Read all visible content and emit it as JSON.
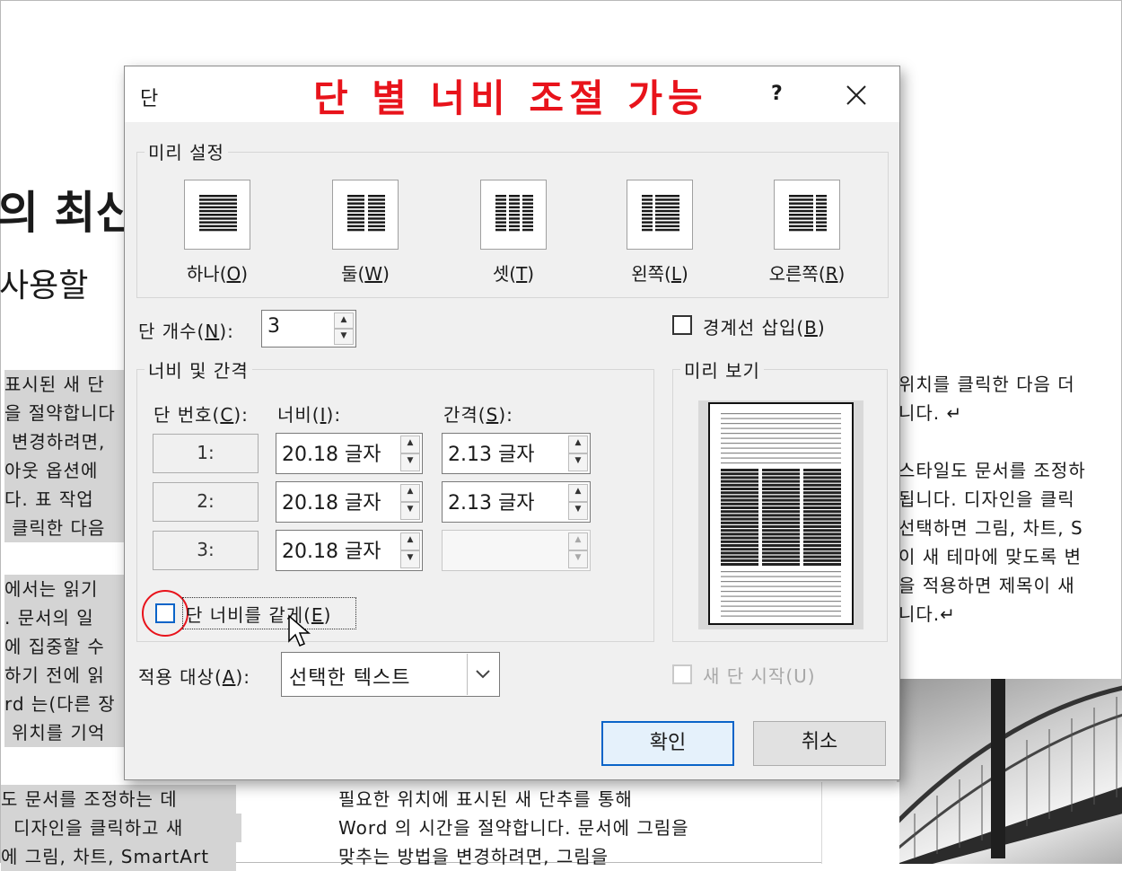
{
  "document": {
    "title_fragment": "의 최신",
    "subtitle_fragment": "사용할",
    "left_column": [
      "표시된 새 단",
      "을 절약합니다",
      "변경하려면,",
      "아웃 옵션에",
      "다. 표 작업 ",
      "클릭한 다음",
      "에서는 읽기",
      ". 문서의 일",
      "에 집중할 수",
      "하기 전에 읽",
      "rd 는(다른 장",
      "위치를 기억"
    ],
    "right_column": [
      "위치를 클릭한 다음 더",
      "니다. ↵",
      "스타일도 문서를 조정하",
      "됩니다. 디자인을 클릭",
      "선택하면 그림, 차트, S",
      "이 새 테마에 맞도록 변",
      "을 적용하면 제목이 새",
      "니다.↵"
    ],
    "bottom_left": [
      "도 문서를 조정하는 데",
      "디자인을 클릭하고 새",
      "에 그림, 차트, SmartArt"
    ],
    "bottom_center": [
      "필요한 위치에 표시된 새 단추를 통해",
      "Word 의 시간을 절약합니다. 문서에 그림을",
      "맞추는 방법을 변경하려면, 그림을"
    ]
  },
  "dialog": {
    "title": "단",
    "banner": "단 별 너비 조절 가능",
    "help": "?",
    "presets_label": "미리 설정",
    "presets": [
      {
        "label": "하나(",
        "key": "O",
        "tail": ")",
        "icon": "one-column-icon"
      },
      {
        "label": "둘(",
        "key": "W",
        "tail": ")",
        "icon": "two-columns-icon"
      },
      {
        "label": "셋(",
        "key": "T",
        "tail": ")",
        "icon": "three-columns-icon"
      },
      {
        "label": "왼쪽(",
        "key": "L",
        "tail": ")",
        "icon": "left-column-icon"
      },
      {
        "label": "오른쪽(",
        "key": "R",
        "tail": ")",
        "icon": "right-column-icon"
      }
    ],
    "num_columns_label": "단 개수(",
    "num_columns_key": "N",
    "num_columns_tail": "):",
    "num_columns_value": "3",
    "line_between_label": "경계선 삽입(",
    "line_between_key": "B",
    "line_between_tail": ")",
    "width_spacing_label": "너비 및 간격",
    "col_header": "단 번호(",
    "col_header_key": "C",
    "col_header_tail": "):",
    "width_header": "너비(",
    "width_header_key": "I",
    "width_header_tail": "):",
    "spacing_header": "간격(",
    "spacing_header_key": "S",
    "spacing_header_tail": "):",
    "rows": [
      {
        "num": "1:",
        "width": "20.18 글자",
        "spacing": "2.13 글자"
      },
      {
        "num": "2:",
        "width": "20.18 글자",
        "spacing": "2.13 글자"
      },
      {
        "num": "3:",
        "width": "20.18 글자",
        "spacing": ""
      }
    ],
    "equal_width_label": "단 너비를 같게(",
    "equal_width_key": "E",
    "equal_width_tail": ")",
    "preview_label": "미리 보기",
    "apply_to_label": "적용 대상(",
    "apply_to_key": "A",
    "apply_to_tail": "):",
    "apply_to_value": "선택한 텍스트",
    "new_column_label": "새 단 시작(U)",
    "ok": "확인",
    "cancel": "취소"
  },
  "colors": {
    "banner": "#e8131b",
    "accent": "#0a64c8"
  }
}
